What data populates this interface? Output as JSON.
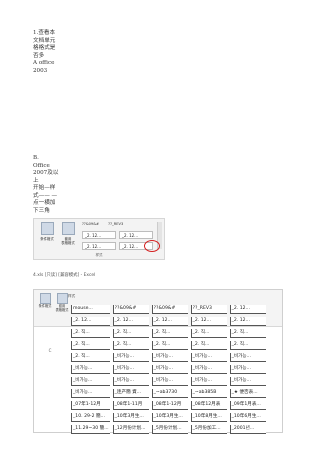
{
  "para1_lines": [
    "1.查看本",
    "文档单元",
    "格格式是",
    "否多",
    "A office",
    "2003"
  ],
  "para2_lines": [
    "B.",
    "Office",
    "2007及以",
    "上",
    "开始—样",
    "式—— —",
    "点一横加",
    "下三角"
  ],
  "ribbon": {
    "buttons": [
      "条件格式",
      "套用\n表格格式"
    ],
    "tabs": [
      "??&09&#",
      "??_REV3"
    ],
    "cells_row1": [
      "_2. 12...",
      "_2. 12..."
    ],
    "cells_row2": [
      "_2. 12...",
      "_2. 12..."
    ],
    "group_label": "样式"
  },
  "caption": "4.xls [只读] [兼容模式] - Excel",
  "sheet": {
    "buttons": [
      "条件格式",
      "套用\n表格格式"
    ],
    "group_header": "样式",
    "row_marker": "C",
    "rows": [
      [
        "mouse...",
        "??&09&#",
        "??&09&#",
        "??_REV3",
        "_2. 12..."
      ],
      [
        "_2. 12...",
        "_2. 12...",
        "_2. 12...",
        "_2. 12...",
        "_2. 12..."
      ],
      [
        "_2. 직...",
        "_2. 직...",
        "_2. 직...",
        "_2. 직...",
        "_2. 직..."
      ],
      [
        "_2. 직...",
        "_2. 직...",
        "_2. 직...",
        "_2. 직...",
        "_2. 직..."
      ],
      [
        "_2. 직...",
        "_비가능...",
        "_비가능...",
        "_비가능...",
        "_비가능..."
      ],
      [
        "_비가능...",
        "_비가능...",
        "_비가능...",
        "_비가능...",
        "_비가능..."
      ],
      [
        "_비가능...",
        "_비가능...",
        "_비가능...",
        "_비가능...",
        "_비가능..."
      ],
      [
        "_비가능...",
        "_连产簡 資...",
        "_~ab3730",
        "_~ab385B",
        "_★ 便否表..."
      ],
      [
        "_07年1-12月",
        "_08年1-11月",
        "_08年1-12月",
        "_08年12月表",
        "_09年1月表..."
      ],
      [
        "_10. 29-2 簡...",
        "_10年3月生...",
        "_10年3月生...",
        "_10年8月生...",
        "_10年6月生..."
      ],
      [
        "_11.29~30 簡...",
        "_12月份计划...",
        "_5月份计划...",
        "_5月份加工...",
        "_2001년..."
      ]
    ]
  }
}
